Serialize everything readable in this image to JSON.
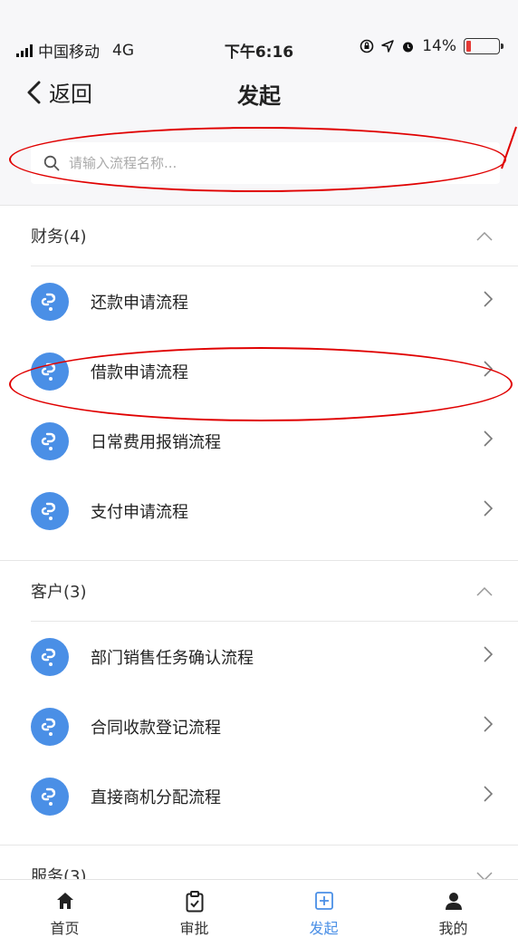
{
  "status_bar": {
    "carrier": "中国移动",
    "network": "4G",
    "time": "下午6:16",
    "battery": "14%",
    "icons": [
      "signal-icon",
      "lock-rotation-icon",
      "location-icon",
      "alarm-icon",
      "battery-icon"
    ],
    "battery_level": 0.14
  },
  "nav": {
    "back_label": "返回",
    "title": "发起"
  },
  "search": {
    "placeholder": "请输入流程名称..."
  },
  "sections": [
    {
      "title": "财务(4)",
      "expanded": true,
      "items": [
        "还款申请流程",
        "借款申请流程",
        "日常费用报销流程",
        "支付申请流程"
      ]
    },
    {
      "title": "客户(3)",
      "expanded": true,
      "items": [
        "部门销售任务确认流程",
        "合同收款登记流程",
        "直接商机分配流程"
      ]
    },
    {
      "title": "服务(3)",
      "expanded": false,
      "items": []
    }
  ],
  "tabbar": {
    "tabs": [
      {
        "label": "首页",
        "icon": "home-icon",
        "active": false
      },
      {
        "label": "审批",
        "icon": "checklist-icon",
        "active": false
      },
      {
        "label": "发起",
        "icon": "plus-square-icon",
        "active": true
      },
      {
        "label": "我的",
        "icon": "person-icon",
        "active": false
      }
    ]
  },
  "colors": {
    "accent": "#4a8fe6",
    "annotation": "#e00000",
    "background_header": "#f7f7f9"
  }
}
